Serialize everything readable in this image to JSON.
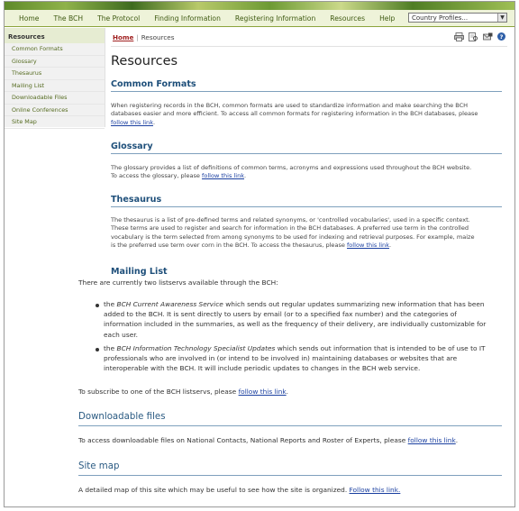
{
  "nav": {
    "items": [
      "Home",
      "The BCH",
      "The Protocol",
      "Finding Information",
      "Registering Information",
      "Resources",
      "Help"
    ],
    "country_select": "Country Profiles..."
  },
  "sidebar": {
    "heading": "Resources",
    "items": [
      "Common Formats",
      "Glossary",
      "Thesaurus",
      "Mailing List",
      "Downloadable Files",
      "Online Conferences",
      "Site Map"
    ]
  },
  "breadcrumb": {
    "home": "Home",
    "separator": "|",
    "current": "Resources"
  },
  "toolbar": {
    "icons": [
      "print-icon",
      "print-preview-icon",
      "email-icon",
      "help-icon"
    ],
    "help_glyph": "?"
  },
  "page": {
    "title": "Resources"
  },
  "common_formats": {
    "title": "Common Formats",
    "text_1": "When registering records in the BCH, common formats are used to standardize information and make searching the BCH",
    "text_2": "databases easier and more efficient. To access all common formats for registering information in the BCH databases, please",
    "link": "follow this link",
    "tail": "."
  },
  "glossary": {
    "title": "Glossary",
    "text_1": "The glossary provides a list of definitions of common terms, acronyms and expressions used throughout the BCH website.",
    "text_2": "To access the glossary, please",
    "link": "follow this link",
    "tail": "."
  },
  "thesaurus": {
    "title": "Thesaurus",
    "text_1": "The thesaurus is a list of pre-defined terms and related synonyms, or 'controlled vocabularies', used in a specific context.",
    "text_2": "These terms are used to register and search for information in the BCH databases. A preferred use term in the controlled",
    "text_3": "vocabulary is the term selected from among synonyms to be used for indexing and retrieval purposes. For example, maize",
    "text_4": "is the preferred use term over corn in the BCH. To access the thesaurus, please",
    "link": "follow this link",
    "tail": "."
  },
  "mailing_list": {
    "title": "Mailing List",
    "intro": "There are currently two listservs available through the BCH:",
    "bullet1": {
      "em": "BCH Current Awareness Service",
      "pre": "the",
      "line1": "which sends out regular updates summarizing new information that has been",
      "line2": "added to the BCH. It is sent directly to users by email (or to a specified fax number) and the categories of",
      "line3": "information included in the summaries, as well as the frequency of their delivery, are individually customizable for",
      "line4": "each user."
    },
    "bullet2": {
      "em": "BCH Information Technology Specialist Updates",
      "pre": "the",
      "line1": "which sends out information that is intended to be of use to IT",
      "line2": "professionals who are involved in (or intend to be involved in) maintaining databases or websites that are",
      "line3": "interoperable with the BCH. It will include periodic updates to changes in the BCH web service."
    },
    "subscribe": "To subscribe to one of the BCH listservs, please",
    "link": "follow this link",
    "tail": "."
  },
  "downloadable": {
    "title": "Downloadable files",
    "text": "To access downloadable files on National Contacts, National Reports and Roster of Experts, please",
    "link": "follow this link",
    "tail": "."
  },
  "sitemap": {
    "title": "Site map",
    "text": "A detailed map of this site which may be useful to see how the site is organized.",
    "link": "Follow this link."
  }
}
